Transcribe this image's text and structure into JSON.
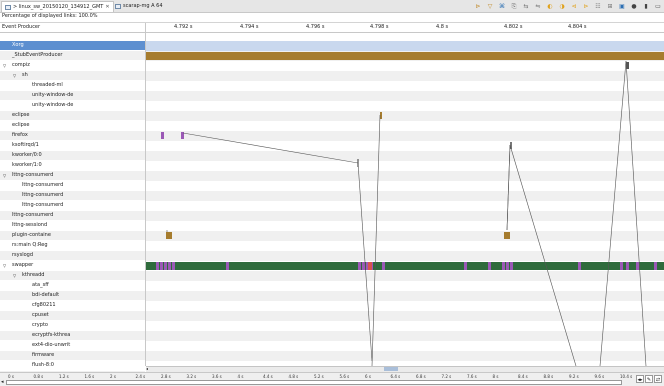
{
  "tabs": [
    {
      "label": "> linux_sw_20150120_134912_GMT",
      "active": true
    },
    {
      "label": "scarap-mg A 64",
      "active": false
    }
  ],
  "toolbar_icons": [
    "filter-icon",
    "filter-icon",
    "resource-icon",
    "hide-arrows-icon",
    "align-icon",
    "zoom-icon",
    "prev-event-icon",
    "next-event-icon",
    "prev-marker-icon",
    "next-marker-icon",
    "legend-icon",
    "zoom-in-icon",
    "zoom-out-icon",
    "view-menu-icon",
    "minimize-icon"
  ],
  "percentage_label": "Percentage of displayed links: 100.0%",
  "tree_header": "Event Producer",
  "time_ticks": [
    "4.792 s",
    "4.794 s",
    "4.796 s",
    "4.798 s",
    "4.8 s",
    "4.802 s",
    "4.804 s"
  ],
  "producers": [
    {
      "label": "Xorg",
      "indent": 0,
      "arrow": ""
    },
    {
      "label": "_StubEventProducer",
      "indent": 0,
      "arrow": ""
    },
    {
      "label": "compiz",
      "indent": 0,
      "arrow": "▽"
    },
    {
      "label": "sh",
      "indent": 1,
      "arrow": "▽"
    },
    {
      "label": "threaded-ml",
      "indent": 2,
      "arrow": ""
    },
    {
      "label": "unity-window-de",
      "indent": 2,
      "arrow": ""
    },
    {
      "label": "unity-window-de",
      "indent": 2,
      "arrow": ""
    },
    {
      "label": "eclipse",
      "indent": 0,
      "arrow": ""
    },
    {
      "label": "eclipse",
      "indent": 0,
      "arrow": ""
    },
    {
      "label": "firefox",
      "indent": 0,
      "arrow": ""
    },
    {
      "label": "ksoftirqd/1",
      "indent": 0,
      "arrow": ""
    },
    {
      "label": "kworker/0:0",
      "indent": 0,
      "arrow": ""
    },
    {
      "label": "kworker/1:0",
      "indent": 0,
      "arrow": ""
    },
    {
      "label": "lttng-consumerd",
      "indent": 0,
      "arrow": "▽"
    },
    {
      "label": "lttng-consumerd",
      "indent": 1,
      "arrow": ""
    },
    {
      "label": "lttng-consumerd",
      "indent": 1,
      "arrow": ""
    },
    {
      "label": "lttng-consumerd",
      "indent": 1,
      "arrow": ""
    },
    {
      "label": "lttng-consumerd",
      "indent": 0,
      "arrow": ""
    },
    {
      "label": "lttng-sessiond",
      "indent": 0,
      "arrow": ""
    },
    {
      "label": "plugin-containe",
      "indent": 0,
      "arrow": ""
    },
    {
      "label": "rs:main Q:Reg",
      "indent": 0,
      "arrow": ""
    },
    {
      "label": "rsyslogd",
      "indent": 0,
      "arrow": ""
    },
    {
      "label": "swapper",
      "indent": 0,
      "arrow": "▽"
    },
    {
      "label": "kthreadd",
      "indent": 1,
      "arrow": "▽"
    },
    {
      "label": "ata_sff",
      "indent": 2,
      "arrow": ""
    },
    {
      "label": "bdi-default",
      "indent": 2,
      "arrow": ""
    },
    {
      "label": "cfg80211",
      "indent": 2,
      "arrow": ""
    },
    {
      "label": "cpuset",
      "indent": 2,
      "arrow": ""
    },
    {
      "label": "crypto",
      "indent": 2,
      "arrow": ""
    },
    {
      "label": "ecryptfs-kthrea",
      "indent": 2,
      "arrow": ""
    },
    {
      "label": "ext4-dio-unwrit",
      "indent": 2,
      "arrow": ""
    },
    {
      "label": "firmware",
      "indent": 2,
      "arrow": ""
    },
    {
      "label": "flush-8:0",
      "indent": 2,
      "arrow": ""
    },
    {
      "label": "flush-ecryptfs-",
      "indent": 2,
      "arrow": ""
    }
  ],
  "bottom_ticks": [
    "0 s",
    "0.8 s",
    "1.2 s",
    "1.6 s",
    "2 s",
    "2.4 s",
    "2.8 s",
    "3.2 s",
    "3.6 s",
    "4 s",
    "4.4 s",
    "4.8 s",
    "5.2 s",
    "5.6 s",
    "6 s",
    "6.4 s",
    "6.8 s",
    "7.2 s",
    "7.6 s",
    "8 s",
    "8.4 s",
    "8.8 s",
    "9.2 s",
    "9.6 s",
    "10.4 s"
  ],
  "bottom_buttons": [
    "expand-icon",
    "pin-icon",
    "sync-icon"
  ],
  "colors": {
    "selected": "#5d8fd0",
    "running": "#2f6b3c",
    "brown": "#a67c2e",
    "purple": "#9b59b6",
    "red": "#d9534f"
  }
}
